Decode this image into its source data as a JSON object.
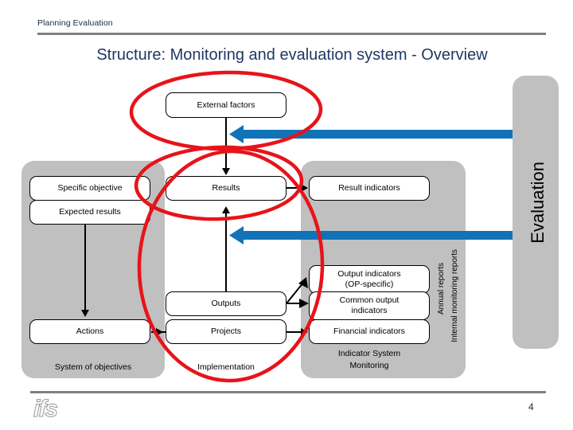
{
  "header": {
    "kicker": "Planning Evaluation",
    "title": "Structure: Monitoring and evaluation system - Overview"
  },
  "footer": {
    "logo_text": "ifs",
    "page_number": "4"
  },
  "colors": {
    "panel_grey": "#c0c0c0",
    "rule_grey": "#808080",
    "title_blue": "#1f3864",
    "arrow_blue": "#1073b8",
    "annotation_red": "#e8131a",
    "box_fill": "#ffffff",
    "box_stroke": "#000000"
  },
  "diagram": {
    "top_box": {
      "label": "External factors"
    },
    "panels": [
      {
        "id": "system-of-objectives",
        "caption": "System of objectives"
      },
      {
        "id": "implementation",
        "caption": "Implementation"
      },
      {
        "id": "indicator-system-monitoring",
        "caption": "Indicator System\nMonitoring",
        "caption_line1": "Indicator System",
        "caption_line2": "Monitoring"
      },
      {
        "id": "evaluation",
        "caption": "Evaluation"
      }
    ],
    "boxes": {
      "specific_objective": "Specific objective",
      "expected_results": "Expected results",
      "actions": "Actions",
      "results": "Results",
      "outputs": "Outputs",
      "projects": "Projects",
      "result_indicators": "Result indicators",
      "output_indicators_line1": "Output indicators",
      "output_indicators_line2": "(OP-specific)",
      "common_output_line1": "Common output",
      "common_output_line2": "indicators",
      "financial_indicators": "Financial indicators"
    },
    "captions": {
      "system_of_objectives": "System of objectives",
      "implementation": "Implementation",
      "indicator_system_line1": "Indicator System",
      "indicator_system_line2": "Monitoring",
      "evaluation": "Evaluation"
    },
    "vertical_labels": {
      "annual_reports": "Annual reports",
      "internal_monitoring_reports": "Internal monitoring reports"
    }
  },
  "annotations": {
    "ellipse_external_factors": "red-ellipse-around-external-factors",
    "ellipse_results": "red-ellipse-around-results",
    "circle_implementation": "red-circle-around-implementation-column"
  }
}
